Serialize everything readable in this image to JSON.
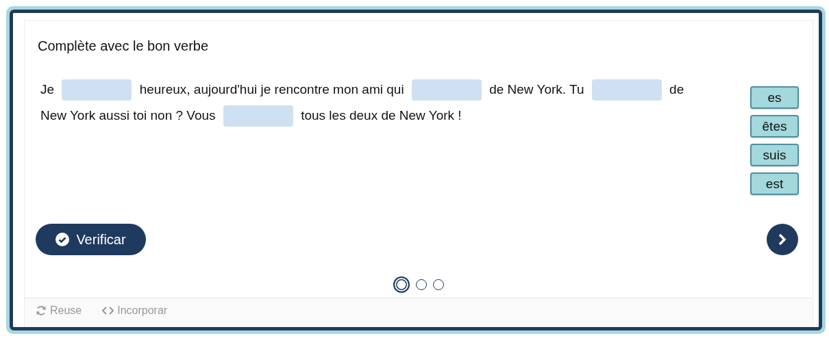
{
  "title": "Complète avec le bon verbe",
  "sentence": [
    {
      "kind": "text",
      "text": "Je"
    },
    {
      "kind": "blank"
    },
    {
      "kind": "text",
      "text": "heureux, aujourd'hui je rencontre mon ami qui"
    },
    {
      "kind": "blank"
    },
    {
      "kind": "text",
      "text": "de New York. Tu"
    },
    {
      "kind": "blank"
    },
    {
      "kind": "text",
      "text": "de"
    },
    {
      "kind": "text",
      "text": "New York aussi toi non ? Vous"
    },
    {
      "kind": "blank"
    },
    {
      "kind": "text",
      "text": "tous les deux de New York !"
    }
  ],
  "words": [
    "es",
    "êtes",
    "suis",
    "est"
  ],
  "check_button": "Verificar",
  "pages": [
    {
      "selected": true
    },
    {
      "selected": false
    },
    {
      "selected": false
    }
  ],
  "footer": [
    {
      "kind": "reuse",
      "label": "Reuse"
    },
    {
      "kind": "embed",
      "label": "Incorporar"
    }
  ]
}
